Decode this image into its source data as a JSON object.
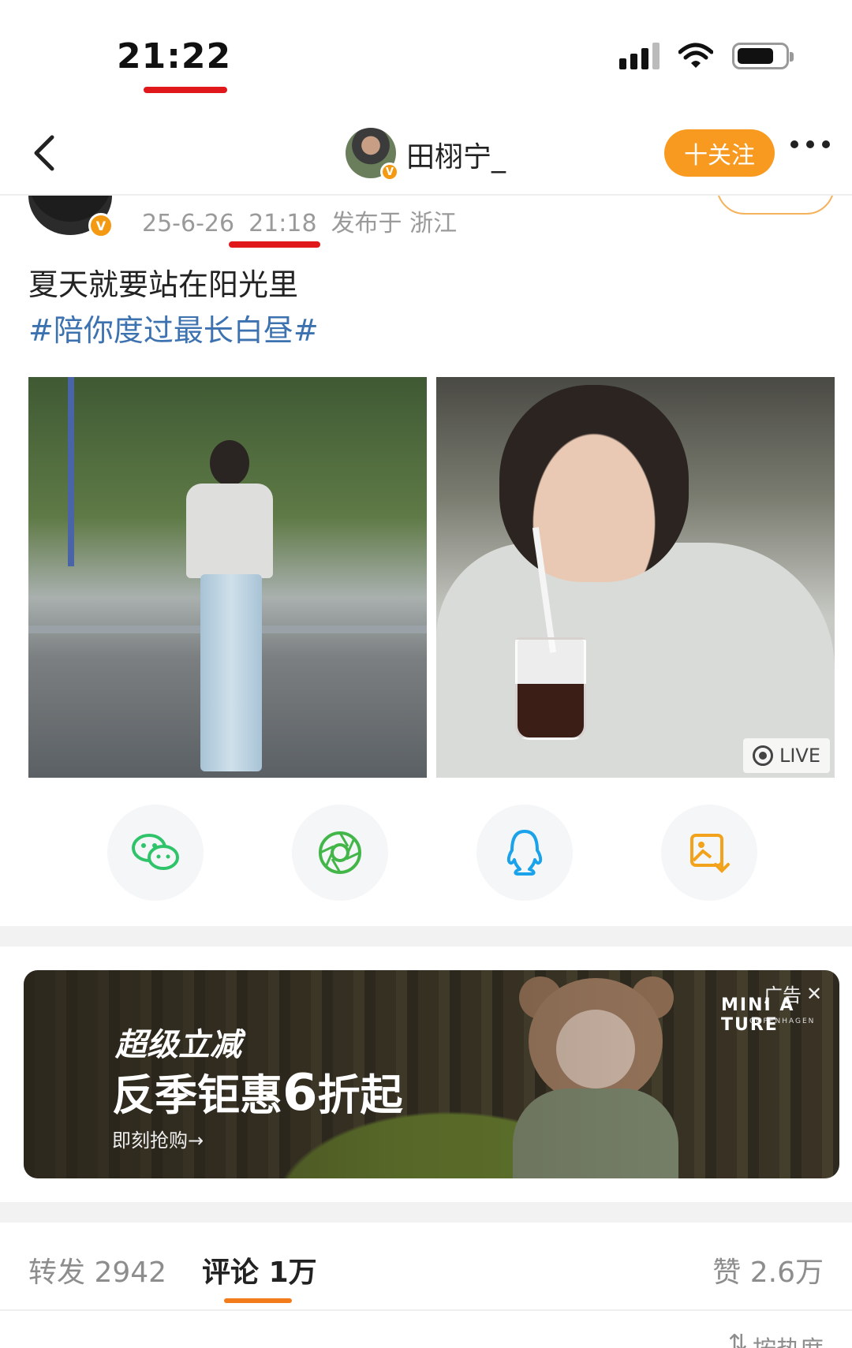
{
  "status_bar": {
    "time": "21:22"
  },
  "nav": {
    "name": "田栩宁_",
    "follow_label": "十关注"
  },
  "post": {
    "date": "25-6-26",
    "time": "21:18",
    "location": "发布于 浙江",
    "text": "夏天就要站在阳光里",
    "topic": "#陪你度过最长白昼#"
  },
  "photos": {
    "live_label": "LIVE"
  },
  "share": [
    {
      "icon": "wechat-icon"
    },
    {
      "icon": "moments-icon"
    },
    {
      "icon": "qq-icon"
    },
    {
      "icon": "save-image-icon"
    }
  ],
  "ad": {
    "label": "广告",
    "close": "✕",
    "brand": "MINI A TURE",
    "brand_sub": "COPENHAGEN",
    "headline1": "超级立减",
    "headline2_prefix": "反季钜惠",
    "headline2_number": "6",
    "headline2_suffix": "折起",
    "cta": "即刻抢购→"
  },
  "tabs": {
    "repost_label": "转发",
    "repost_count": "2942",
    "comment_label": "评论",
    "comment_count": "1万",
    "like_label": "赞",
    "like_count": "2.6万"
  },
  "sort": {
    "label": "按热度"
  },
  "colors": {
    "accent": "#f99a20",
    "topic": "#3d72b0",
    "annotation": "#e0181b",
    "tab_indicator": "#f27b1b"
  }
}
